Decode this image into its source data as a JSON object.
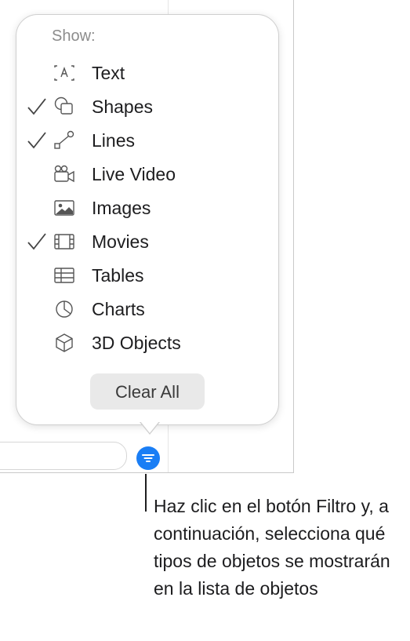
{
  "popover": {
    "heading": "Show:",
    "items": [
      {
        "label": "Text",
        "icon": "text-box-icon",
        "checked": false
      },
      {
        "label": "Shapes",
        "icon": "shapes-icon",
        "checked": true
      },
      {
        "label": "Lines",
        "icon": "lines-icon",
        "checked": true
      },
      {
        "label": "Live Video",
        "icon": "live-video-icon",
        "checked": false
      },
      {
        "label": "Images",
        "icon": "image-icon",
        "checked": false
      },
      {
        "label": "Movies",
        "icon": "film-icon",
        "checked": true
      },
      {
        "label": "Tables",
        "icon": "table-icon",
        "checked": false
      },
      {
        "label": "Charts",
        "icon": "pie-chart-icon",
        "checked": false
      },
      {
        "label": "3D Objects",
        "icon": "cube-icon",
        "checked": false
      }
    ],
    "clear_all_label": "Clear All"
  },
  "filter_button": {
    "icon": "filter-icon",
    "color": "#1a7ef5"
  },
  "callout": {
    "text": "Haz clic en el botón Filtro y, a continuación, selecciona qué tipos de objetos se mostrarán en la lista de objetos"
  },
  "colors": {
    "accent": "#1a7ef5",
    "heading": "#8c8c8c",
    "text": "#1d1d1f"
  }
}
